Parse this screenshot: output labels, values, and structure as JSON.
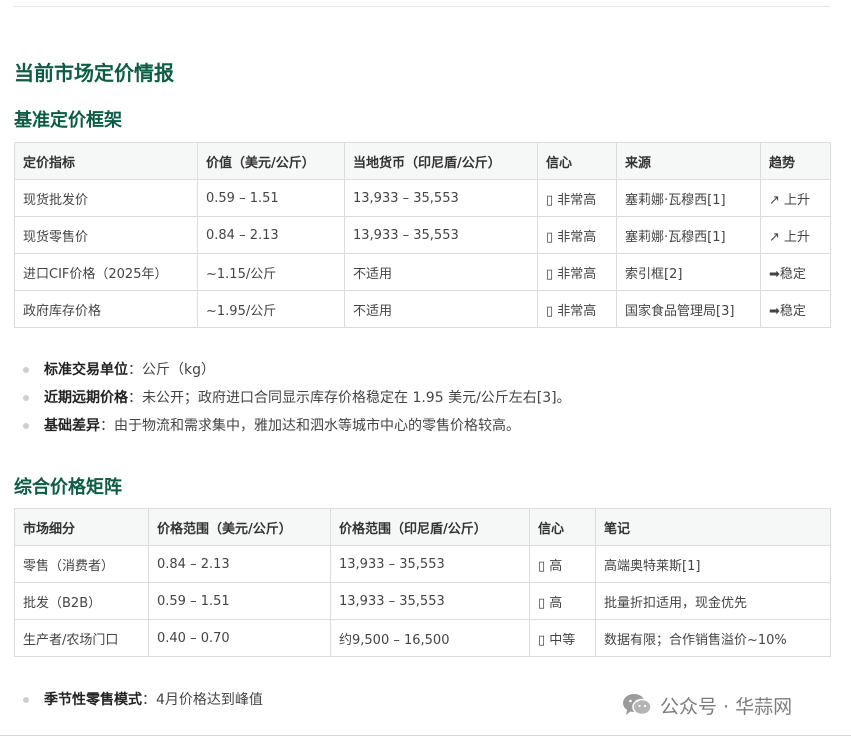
{
  "headings": {
    "main": "当前市场定价情报",
    "pricing_framework": "基准定价框架",
    "price_matrix": "综合价格矩阵"
  },
  "pricing_table": {
    "headers": [
      "定价指标",
      "价值（美元/公斤）",
      "当地货币（印尼盾/公斤）",
      "信心",
      "来源",
      "趋势"
    ],
    "rows": [
      [
        "现货批发价",
        "0.59 – 1.51",
        "13,933 – 35,553",
        "▯ 非常高",
        "塞莉娜·瓦穆西[1]",
        "↗ 上升"
      ],
      [
        "现货零售价",
        "0.84 – 2.13",
        "13,933 – 35,553",
        "▯ 非常高",
        "塞莉娜·瓦穆西[1]",
        "↗ 上升"
      ],
      [
        "进口CIF价格（2025年）",
        "~1.15/公斤",
        "不适用",
        "▯ 非常高",
        "索引框[2]",
        "➡稳定"
      ],
      [
        "政府库存价格",
        "~1.95/公斤",
        "不适用",
        "▯ 非常高",
        "国家食品管理局[3]",
        "➡稳定"
      ]
    ]
  },
  "notes": [
    {
      "label": "标准交易单位",
      "sep": "：",
      "text": "公斤（kg）"
    },
    {
      "label": "近期远期价格",
      "sep": "：",
      "text": "未公开；政府进口合同显示库存价格稳定在 1.95 美元/公斤左右[3]。"
    },
    {
      "label": "基础差异",
      "sep": "：",
      "text": "由于物流和需求集中，雅加达和泗水等城市中心的零售价格较高。"
    }
  ],
  "matrix_table": {
    "headers": [
      "市场细分",
      "价格范围（美元/公斤）",
      "价格范围（印尼盾/公斤）",
      "信心",
      "笔记"
    ],
    "rows": [
      [
        "零售（消费者）",
        "0.84 – 2.13",
        "13,933 – 35,553",
        "▯ 高",
        "高端奥特莱斯[1]"
      ],
      [
        "批发（B2B）",
        "0.59 – 1.51",
        "13,933 – 35,553",
        "▯ 高",
        "批量折扣适用，现金优先"
      ],
      [
        "生产者/农场门口",
        "0.40 – 0.70",
        "约9,500 – 16,500",
        "▯ 中等",
        "数据有限；合作销售溢价~10%"
      ]
    ]
  },
  "seasonal": {
    "label": "季节性零售模式",
    "sep": "：",
    "text": "4月价格达到峰值"
  },
  "watermark": {
    "text": "公众号 · 华蒜网",
    "icon": "wechat-icon"
  }
}
